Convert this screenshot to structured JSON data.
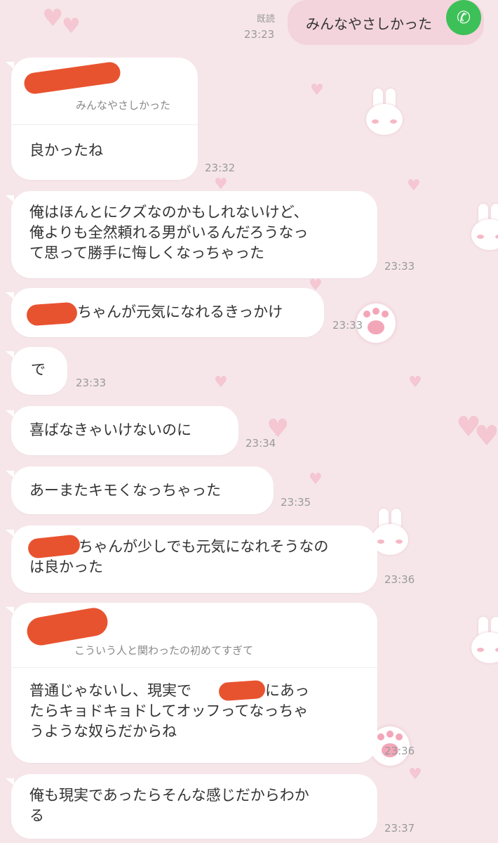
{
  "top": {
    "read_label": "既読",
    "time": "23:23",
    "sent_text": "みんなやさしかった",
    "call_icon": "phone-icon"
  },
  "messages": [
    {
      "quote": "みんなやさしかった",
      "text": "良かったね",
      "time": "23:32"
    },
    {
      "text": "俺はほんとにクズなのかもしれないけど、\n俺よりも全然頼れる男がいるんだろうなっ\nて思って勝手に悔しくなっちゃった",
      "time": "23:33"
    },
    {
      "text": "ちゃんが元気になれるきっかけ",
      "time": "23:33"
    },
    {
      "text": "で",
      "time": "23:33"
    },
    {
      "text": "喜ばなきゃいけないのに",
      "time": "23:34"
    },
    {
      "text": "あーまたキモくなっちゃった",
      "time": "23:35"
    },
    {
      "text": "ちゃんが少しでも元気になれそうなの\nは良かった",
      "time": "23:36"
    },
    {
      "quote": "こういう人と関わったの初めてすぎて",
      "text": "普通じゃないし、現実で　　ちゃんにあっ\nたらキョドキョドしてオッフってなっちゃ\nうような奴らだからね",
      "time": "23:36"
    },
    {
      "text": "俺も現実であったらそんな感じだからわか\nる",
      "time": "23:37"
    }
  ],
  "colors": {
    "background": "#f6e6ea",
    "bubble": "#ffffff",
    "sent_bubble": "#f3d4dc",
    "redaction": "#e8532f",
    "call": "#3dc057"
  }
}
